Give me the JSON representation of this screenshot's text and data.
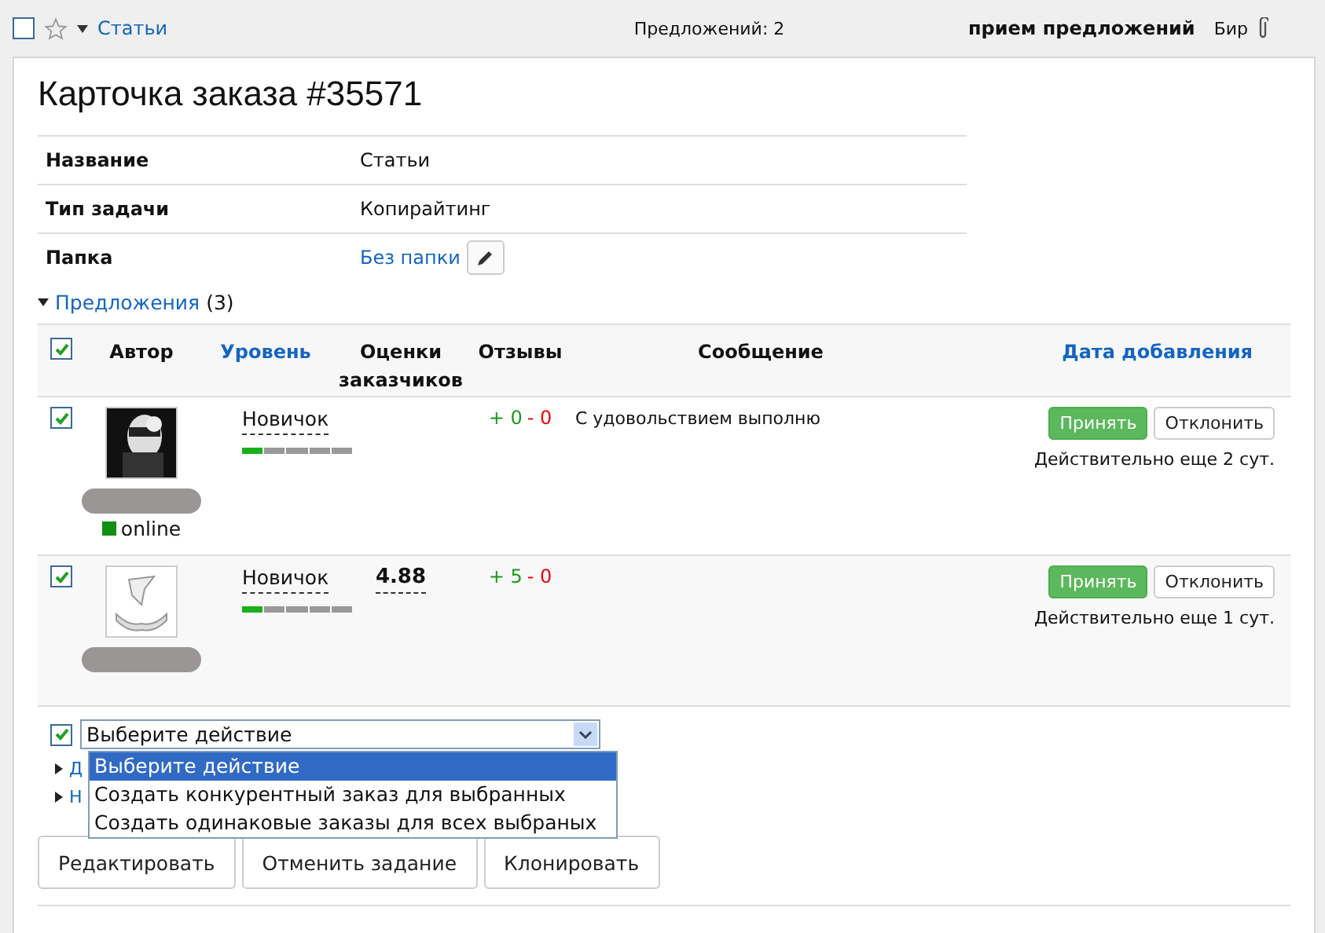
{
  "top_bar": {
    "checked": false,
    "starred": false,
    "breadcrumb": "Статьи",
    "offers_count": "Предложений: 2",
    "status": "прием предложений",
    "user": "Бир"
  },
  "title": "Карточка заказа #35571",
  "info": [
    {
      "label": "Название",
      "value": "Статьи",
      "kind": "text"
    },
    {
      "label": "Тип задачи",
      "value": "Копирайтинг",
      "kind": "text"
    },
    {
      "label": "Папка",
      "value": "Без папки",
      "kind": "link"
    }
  ],
  "proposals": {
    "label": "Предложения",
    "count": "(3)",
    "expanded": true
  },
  "table": {
    "select_all": true,
    "columns": [
      {
        "label": "Автор",
        "sortable": false
      },
      {
        "label": "Уровень",
        "sortable": true
      },
      {
        "label": "Оценки заказчиков",
        "sortable": false
      },
      {
        "label": "Отзывы",
        "sortable": false
      },
      {
        "label": "Сообщение",
        "sortable": false
      },
      {
        "label": "Дата добавления",
        "sortable": true
      }
    ],
    "rows": [
      {
        "checked": true,
        "online": true,
        "online_label": "online",
        "level_name": "Новичок",
        "level": 0.2,
        "rating": "",
        "reviews_plus": "+ 0",
        "reviews_minus": "- 0",
        "message": "С удовольствием выполню",
        "accept": "Принять",
        "decline": "Отклонить",
        "valid": "Действительно еще 2 сут."
      },
      {
        "checked": true,
        "online": false,
        "online_label": "",
        "level_name": "Новичок",
        "level": 0.2,
        "rating": "4.88",
        "reviews_plus": "+ 5",
        "reviews_minus": "- 0",
        "message": "",
        "accept": "Принять",
        "decline": "Отклонить",
        "valid": "Действительно еще 1 сут."
      }
    ]
  },
  "action": {
    "checked": true,
    "value": "Выберите действие",
    "options": [
      {
        "label": "Выберите действие",
        "selected": true
      },
      {
        "label": "Создать конкурентный заказ для выбранных",
        "selected": false
      },
      {
        "label": "Создать одинаковые заказы для всех выбраных",
        "selected": false
      }
    ]
  },
  "sections": [
    {
      "label": "Д"
    },
    {
      "label": "Н"
    }
  ],
  "buttons": [
    "Редактировать",
    "Отменить задание",
    "Клонировать"
  ]
}
